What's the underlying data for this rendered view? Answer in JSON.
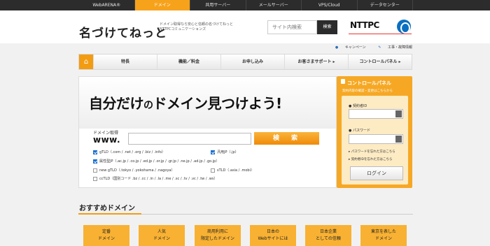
{
  "topnav": {
    "tabs": [
      "WebARENA®",
      "ドメイン",
      "共用サーバー",
      "メールサーバー",
      "VPS/Cloud",
      "データセンター"
    ],
    "active": 1
  },
  "header": {
    "logo": "名づけてねっと",
    "tagline1": "ドメイン取得なら安心と信頼の名づけてねっと",
    "tagline2": "NTTPCコミュニケーションズ",
    "search_placeholder": "サイト内検索",
    "search_button": "検索",
    "brand": "NTTPC"
  },
  "sublinks": {
    "campaign": "キャンペーン",
    "maintenance": "工事・故障情報"
  },
  "nav": {
    "items": [
      "特長",
      "機能／料金",
      "お申し込み",
      "お客さまサポート ▸",
      "コントロールパネル ▸"
    ]
  },
  "hero": {
    "title_a": "自分だけ",
    "title_b": "の",
    "title_c": "ドメイン見つけよう!"
  },
  "domain_search": {
    "label": "ドメイン取得",
    "prefix": "www.",
    "button": "検　索"
  },
  "checks": [
    {
      "label": "gTLD（.com / .net / .org / .biz / .info）",
      "checked": true
    },
    {
      "label": "汎用JP（.jp）",
      "checked": true
    },
    {
      "label": "属性型JP（.ac.jp / .co.jp / .ed.jp / .or.jp / .gr.jp / .ne.jp / .ad.jp / .go.jp）",
      "checked": true
    },
    {
      "label": "new gTLD（.tokyo / .yokohama / .nagoya）",
      "checked": false
    },
    {
      "label": "sTLD（.asia / .mobi）",
      "checked": false
    },
    {
      "label": "ccTLD（国別コード .bz / .cc / .in / .la / .me / .sc / .tv / .vc / .tw / .ws）",
      "checked": false
    }
  ],
  "panel": {
    "title": "コントロールパネル",
    "subtitle": "契約内容の確認・変更はこちらから",
    "id_label": "契約者ID",
    "pw_label": "パスワード",
    "forgot_pw": "▸ パスワードを忘れた方はこちら",
    "forgot_id": "▸ 契約者IDを忘れた方はこちら",
    "login": "ログイン"
  },
  "recommend": {
    "title": "おすすめドメイン",
    "cards": [
      [
        "定番",
        "ドメイン"
      ],
      [
        "人気",
        "ドメイン"
      ],
      [
        "商用利用に",
        "限定したドメイン"
      ],
      [
        "日本の",
        "Webサイトには"
      ],
      [
        "日本企業",
        "としての信頼"
      ],
      [
        "東京を表した",
        "ドメイン"
      ]
    ]
  }
}
